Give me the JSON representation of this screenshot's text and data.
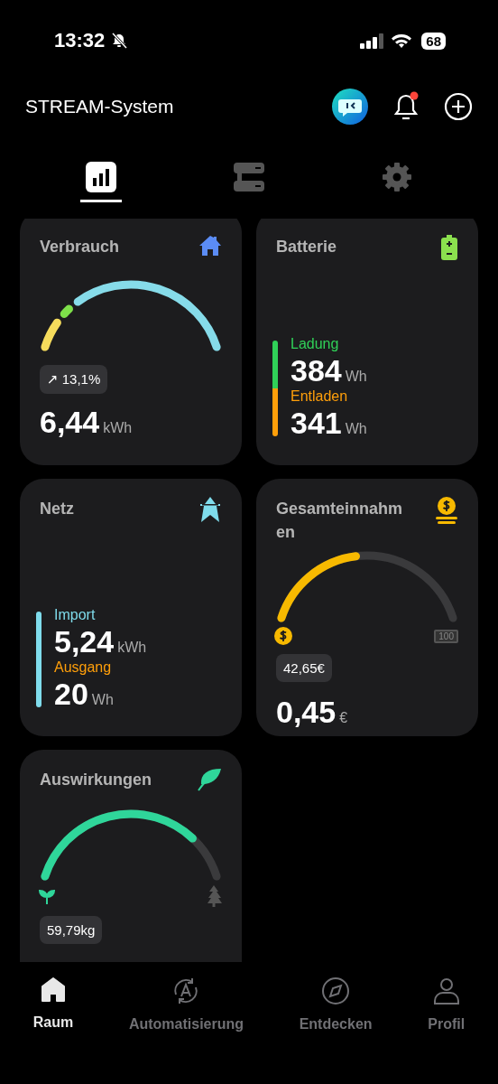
{
  "status_bar": {
    "time": "13:32",
    "battery": "68"
  },
  "header": {
    "title": "STREAM-System",
    "notification_dot": true
  },
  "view_tabs": [
    {
      "kind": "stats",
      "selected": true
    },
    {
      "kind": "devices",
      "selected": false
    },
    {
      "kind": "settings",
      "selected": false
    }
  ],
  "cards": [
    {
      "kind": "consumption",
      "title": "Verbrauch",
      "badge": "↗ 13,1%",
      "value": "6,44",
      "unit": "kWh"
    },
    {
      "kind": "battery",
      "title": "Batterie",
      "bar": [
        {
          "color": "#30d158"
        },
        {
          "color": "#ff9f0a"
        }
      ],
      "rows": [
        {
          "label": "Ladung",
          "color": "#30d158",
          "value": "384",
          "unit": "Wh"
        },
        {
          "label": "Entladen",
          "color": "#ff9f0a",
          "value": "341",
          "unit": "Wh"
        }
      ]
    },
    {
      "kind": "grid",
      "title": "Netz",
      "bar": [
        {
          "color": "#7fdcec"
        }
      ],
      "rows": [
        {
          "label": "Import",
          "color": "#7fdcec",
          "value": "5,24",
          "unit": "kWh"
        },
        {
          "label": "Ausgang",
          "color": "#ff9f0a",
          "value": "20",
          "unit": "Wh"
        }
      ]
    },
    {
      "kind": "revenue",
      "title": "Gesamteinnahmen",
      "color": "#f7b900",
      "end_label": "100",
      "badge": "42,65€",
      "value": "0,45",
      "unit": "€"
    },
    {
      "kind": "impact",
      "title": "Auswirkungen",
      "color": "#2fd69a",
      "badge": "59,79kg"
    }
  ],
  "bottom_nav": [
    {
      "kind": "home",
      "label": "Raum",
      "selected": true
    },
    {
      "kind": "automation",
      "label": "Automatisierung",
      "selected": false
    },
    {
      "kind": "discover",
      "label": "Entdecken",
      "selected": false
    },
    {
      "kind": "profile",
      "label": "Profil",
      "selected": false
    }
  ]
}
